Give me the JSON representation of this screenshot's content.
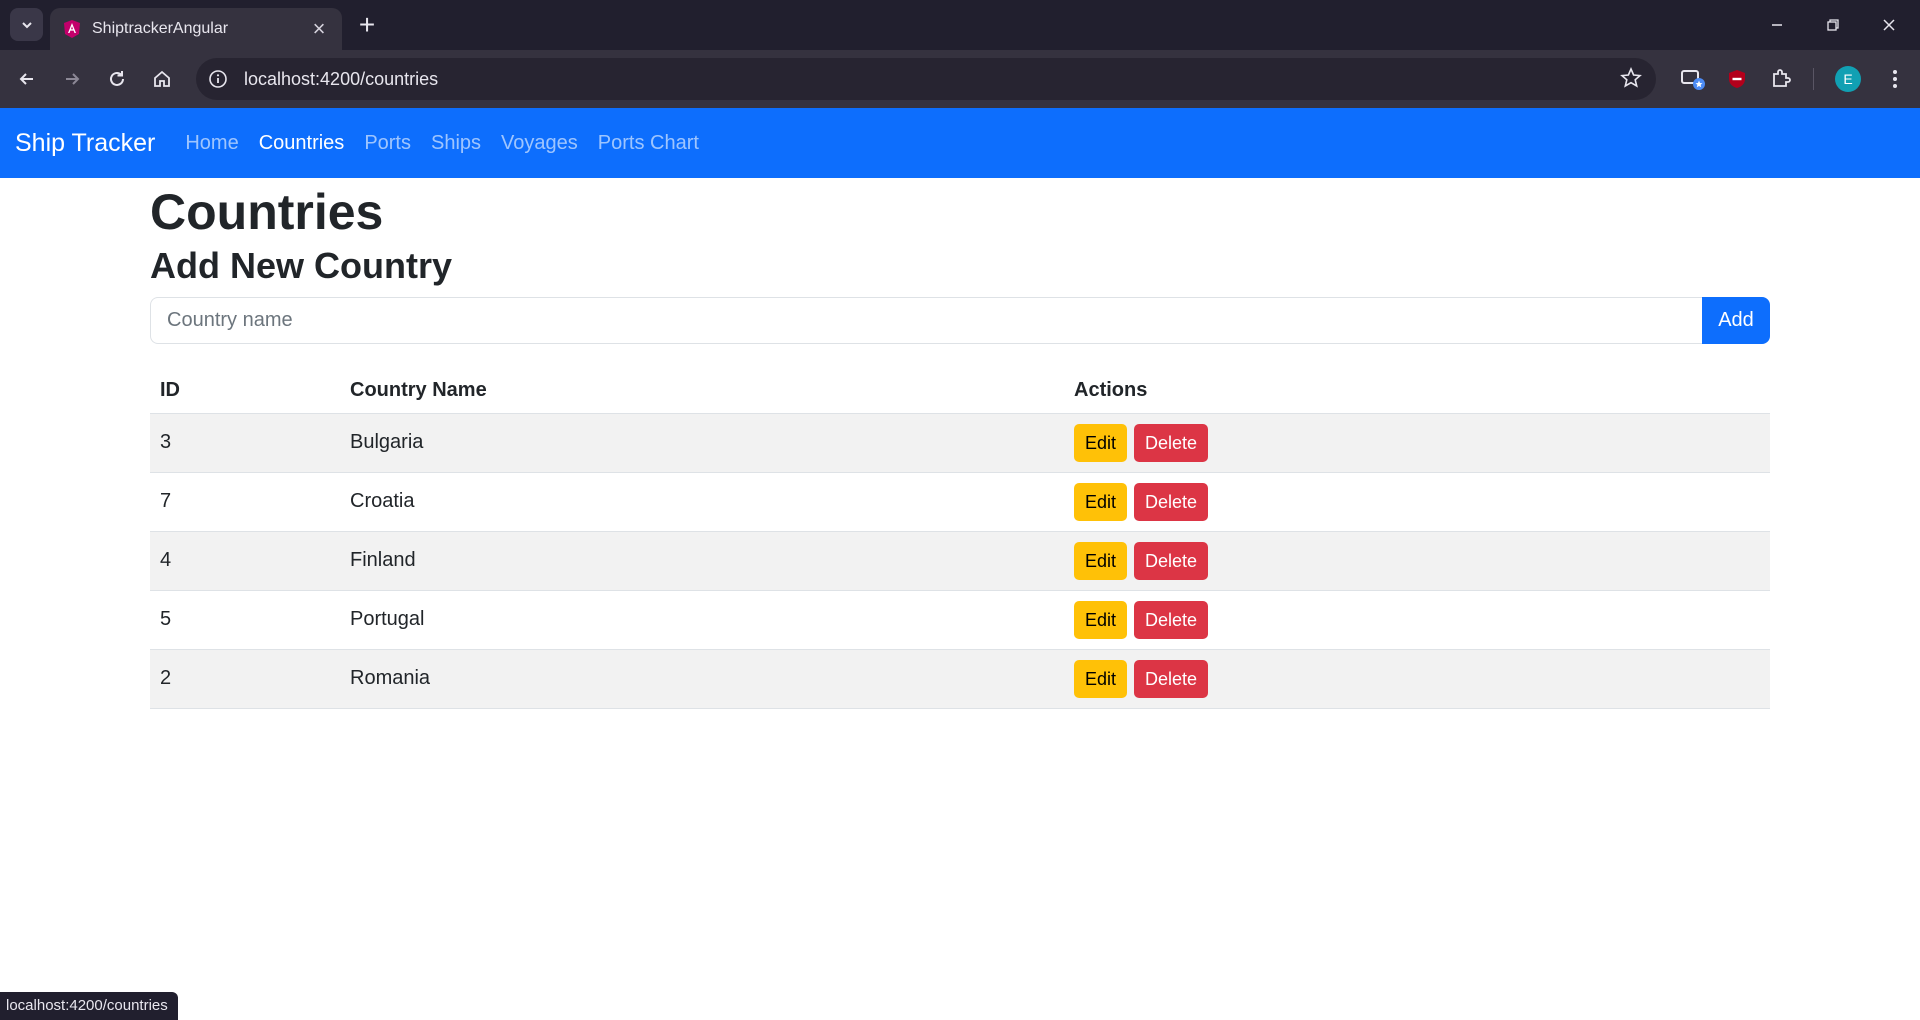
{
  "browser": {
    "tab_title": "ShiptrackerAngular",
    "url": "localhost:4200/countries",
    "profile_initial": "E",
    "status_url": "localhost:4200/countries"
  },
  "navbar": {
    "brand": "Ship Tracker",
    "links": [
      {
        "label": "Home",
        "active": false
      },
      {
        "label": "Countries",
        "active": true
      },
      {
        "label": "Ports",
        "active": false
      },
      {
        "label": "Ships",
        "active": false
      },
      {
        "label": "Voyages",
        "active": false
      },
      {
        "label": "Ports Chart",
        "active": false
      }
    ]
  },
  "page": {
    "title": "Countries",
    "form_title": "Add New Country",
    "input_placeholder": "Country name",
    "input_value": "",
    "add_label": "Add"
  },
  "table": {
    "headers": [
      "ID",
      "Country Name",
      "Actions"
    ],
    "rows": [
      {
        "id": "3",
        "name": "Bulgaria"
      },
      {
        "id": "7",
        "name": "Croatia"
      },
      {
        "id": "4",
        "name": "Finland"
      },
      {
        "id": "5",
        "name": "Portugal"
      },
      {
        "id": "2",
        "name": "Romania"
      }
    ],
    "edit_label": "Edit",
    "delete_label": "Delete"
  },
  "colors": {
    "primary": "#0d6efd",
    "warning": "#ffc107",
    "danger": "#dc3545"
  }
}
